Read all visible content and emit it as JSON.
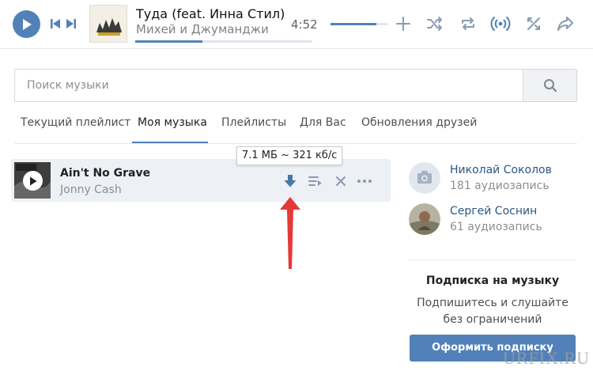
{
  "player": {
    "title": "Туда (feat. Инна Стил)",
    "artist": "Михей и Джуманджи",
    "time": "4:52",
    "progress_fraction": 0.38,
    "volume_fraction": 0.8,
    "icons": [
      "play-icon",
      "prev-icon",
      "next-icon",
      "add-icon",
      "shuffle-icon",
      "repeat-icon",
      "broadcast-icon",
      "similar-icon",
      "share-icon"
    ]
  },
  "search": {
    "placeholder": "Поиск музыки"
  },
  "tabs": [
    {
      "label": "Текущий плейлист",
      "active": false
    },
    {
      "label": "Моя музыка",
      "active": true
    },
    {
      "label": "Плейлисты",
      "active": false
    },
    {
      "label": "Для Вас",
      "active": false
    },
    {
      "label": "Обновления друзей",
      "active": false
    }
  ],
  "track": {
    "title": "Ain't No Grave",
    "artist": "Jonny Cash",
    "tooltip": "7.1 МБ ~ 321 кб/с"
  },
  "friends": [
    {
      "name": "Николай Соколов",
      "count": "181 аудиозапись"
    },
    {
      "name": "Сергей Соснин",
      "count": "61 аудиозапись"
    }
  ],
  "promo": {
    "title": "Подписка на музыку",
    "text": "Подпишитесь и слушайте без ограничений",
    "button": "Оформить подписку"
  },
  "watermark": "URFIX.RU",
  "colors": {
    "accent": "#5181b8",
    "link": "#2a5885",
    "arrow": "#e53935",
    "row_bg": "#edf0f5"
  }
}
